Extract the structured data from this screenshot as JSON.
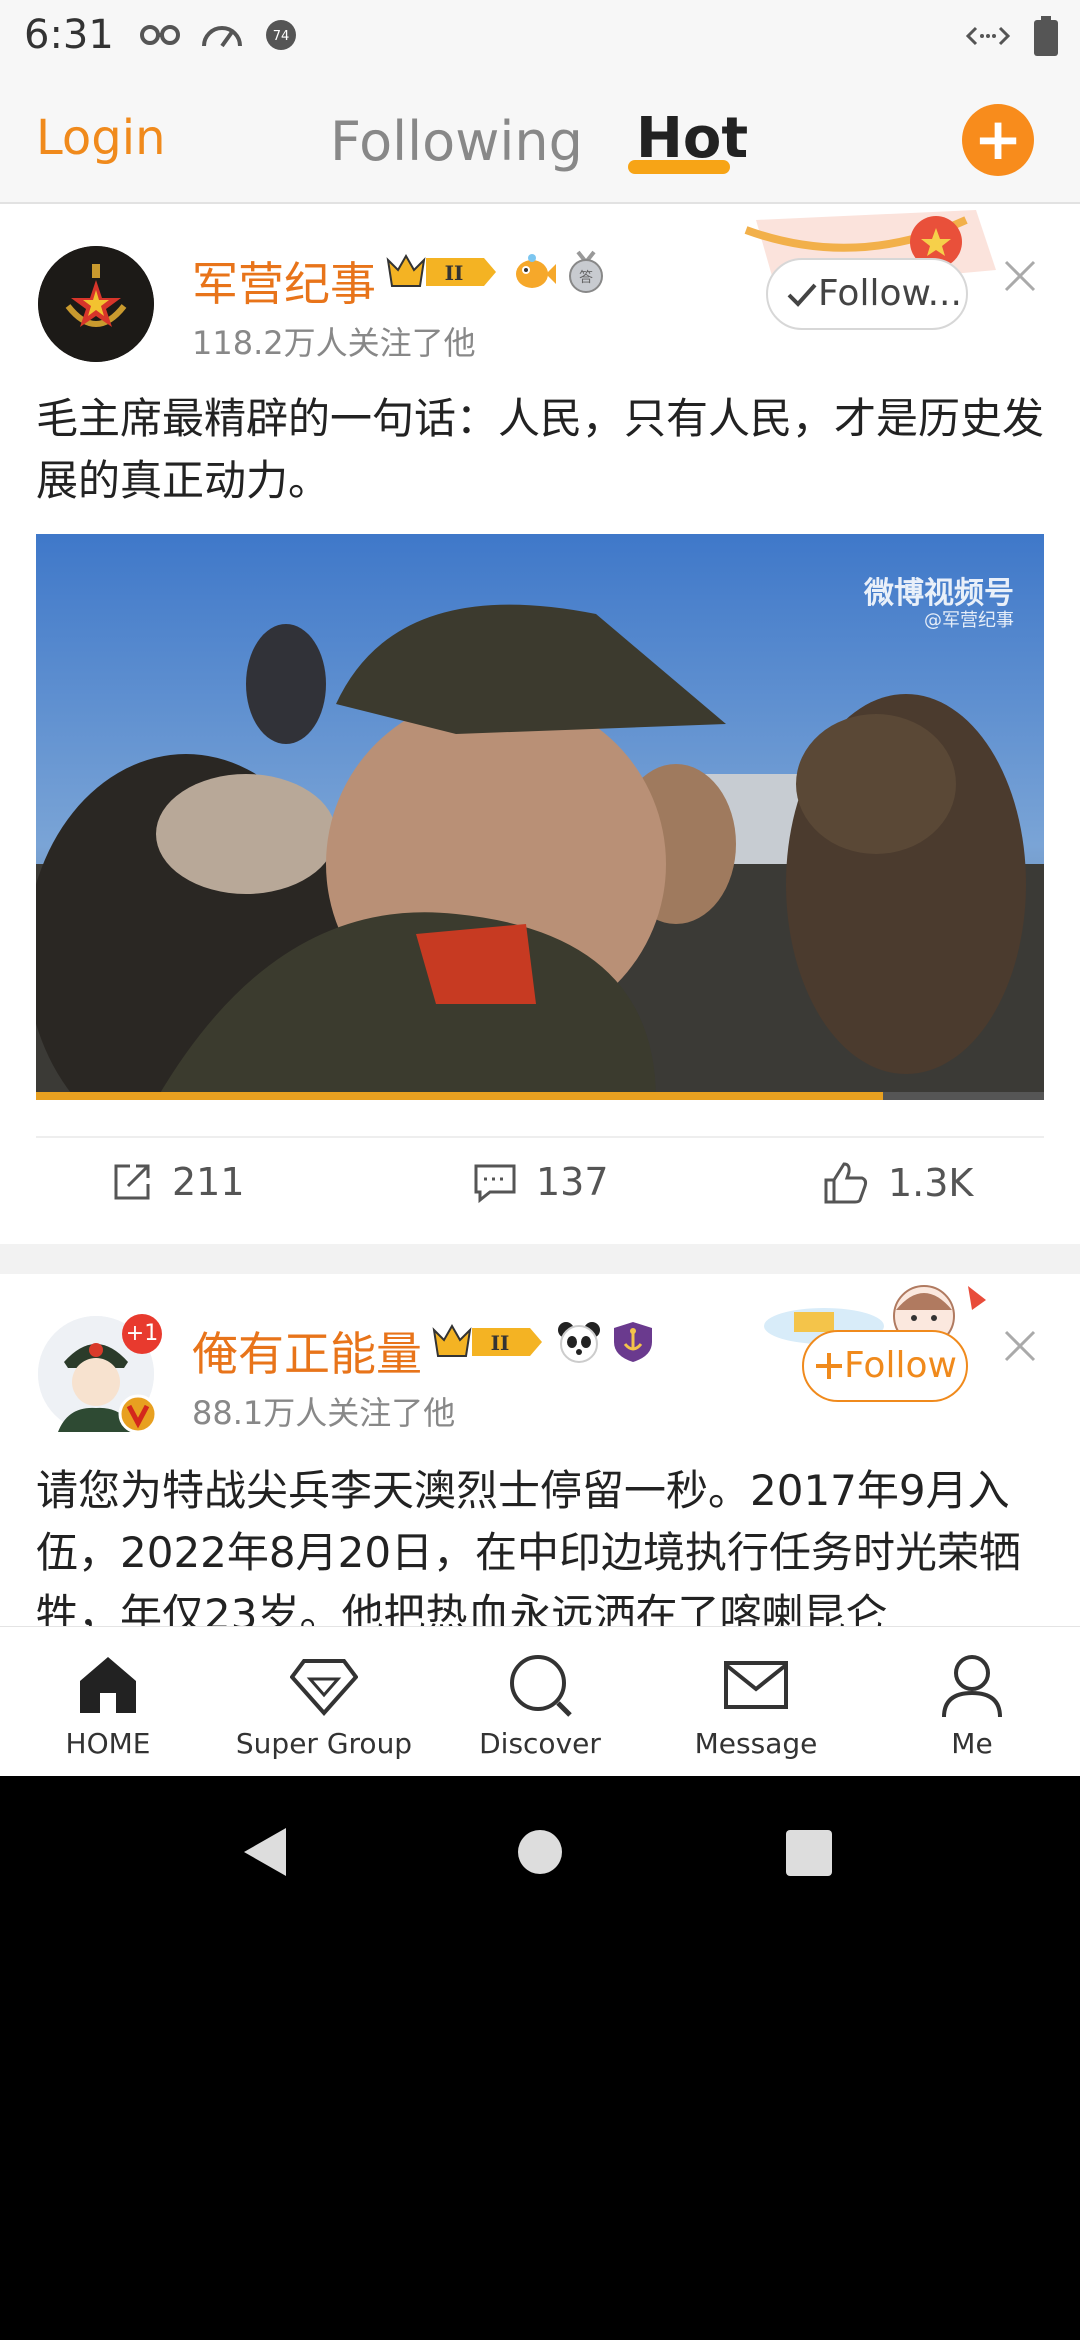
{
  "status_bar": {
    "time": "6:31"
  },
  "top_nav": {
    "login": "Login",
    "following": "Following",
    "hot": "Hot"
  },
  "posts": [
    {
      "author": "军营纪事",
      "followers": "118.2万人关注了他",
      "follow_label": "Follow...",
      "text": "毛主席最精辟的一句话：人民，只有人民，才是历史发展的真正动力。",
      "video": {
        "watermark": "微博视频号",
        "watermark_sub": "@军营纪事",
        "progress_percent": 84
      },
      "actions": {
        "reposts": "211",
        "comments": "137",
        "likes": "1.3K"
      }
    },
    {
      "author": "俺有正能量",
      "followers": "88.1万人关注了他",
      "follow_label": "Follow",
      "avatar_badge": "+1",
      "text": "请您为特战尖兵李天澳烈士停留一秒。2017年9月入伍，2022年8月20日，在中印边境执行任务时光荣牺牲，年仅23岁。他把热血永远洒在了喀喇昆仑"
    }
  ],
  "tab_bar": {
    "items": [
      {
        "label": "HOME",
        "icon": "home-icon"
      },
      {
        "label": "Super Group",
        "icon": "diamond-icon"
      },
      {
        "label": "Discover",
        "icon": "search-icon"
      },
      {
        "label": "Message",
        "icon": "mail-icon"
      },
      {
        "label": "Me",
        "icon": "person-icon"
      }
    ]
  },
  "colors": {
    "accent": "#f08a1c",
    "author": "#e8741a",
    "hot_underline": "#f7a416"
  }
}
